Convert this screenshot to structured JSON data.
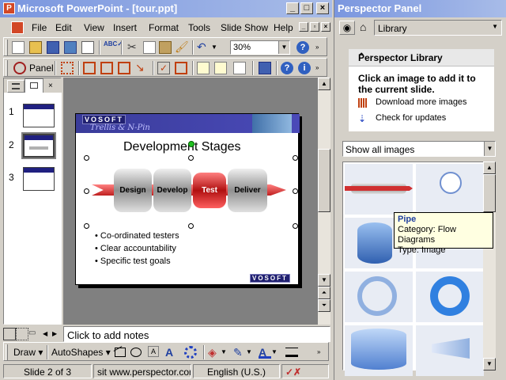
{
  "window": {
    "title": "Microsoft PowerPoint - [tour.ppt]",
    "controls": [
      "_",
      "□",
      "×"
    ]
  },
  "menu": {
    "items": [
      "File",
      "Edit",
      "View",
      "Insert",
      "Format",
      "Tools",
      "Slide Show",
      "Help"
    ]
  },
  "toolbar": {
    "zoom_value": "30%",
    "panel_label": "Panel"
  },
  "thumbnails": {
    "items": [
      {
        "number": "1"
      },
      {
        "number": "2"
      },
      {
        "number": "3"
      }
    ]
  },
  "slide": {
    "logo": "VOSOFT",
    "subtitle": "Trellis & N-Pin",
    "title": "Development Stages",
    "stages": [
      "Design",
      "Develop",
      "Test",
      "Deliver"
    ],
    "bullets": [
      "Co-ordinated testers",
      "Clear accountability",
      "Specific test goals"
    ],
    "footer_logo": "VOSOFT"
  },
  "notes": {
    "placeholder": "Click to add notes"
  },
  "drawbar": {
    "draw_label": "Draw",
    "autoshapes_label": "AutoShapes"
  },
  "status": {
    "slide": "Slide 2 of 3",
    "site": "sit www.perspector.cor",
    "language": "English (U.S.)"
  },
  "perspector": {
    "panel_title": "Perspector Panel",
    "nav_label": "Library",
    "library_header": "Perspector Library",
    "instruction": "Click an image to add it to the current slide.",
    "download_link": "Download more images",
    "update_link": "Check for updates",
    "filter_value": "Show all images",
    "tooltip": {
      "title": "Pipe",
      "category": "Category: Flow Diagrams",
      "type": "Type: Image"
    }
  }
}
